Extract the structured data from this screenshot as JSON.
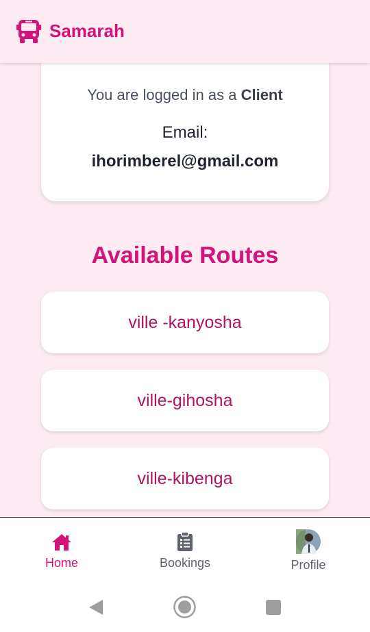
{
  "app": {
    "title": "Samarah",
    "logo_icon": "bus-icon",
    "accent": "#d3127a"
  },
  "account": {
    "logged_in_prefix": "You are logged in as a",
    "role": "Client",
    "email_label": "Email:",
    "email": "ihorimberel@gmail.com"
  },
  "routes": {
    "title": "Available Routes",
    "items": [
      {
        "label": "ville -kanyosha"
      },
      {
        "label": "ville-gihosha"
      },
      {
        "label": "ville-kibenga"
      }
    ]
  },
  "bottom_nav": {
    "items": [
      {
        "label": "Home",
        "icon": "home-icon",
        "active": true
      },
      {
        "label": "Bookings",
        "icon": "clipboard-icon",
        "active": false
      },
      {
        "label": "Profile",
        "icon": "avatar",
        "active": false
      }
    ]
  },
  "system_nav": {
    "icons": [
      "back-icon",
      "home-circle-icon",
      "recents-icon"
    ]
  }
}
